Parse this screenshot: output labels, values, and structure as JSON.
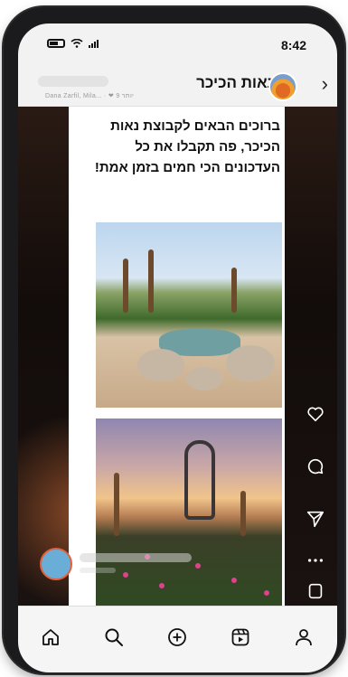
{
  "status_bar": {
    "time": "8:42"
  },
  "header": {
    "title": "נאות הכיכר",
    "subtitle": "Dana Zarfil,  Mila...  ·  ❤  9 יותר"
  },
  "post": {
    "text": "ברוכים הבאים לקבוצת נאות הכיכר, פה תקבלו את כל העדכונים הכי חמים בזמן אמת!",
    "images": [
      {
        "name": "oasis-palms-photo"
      },
      {
        "name": "sculpture-sunset-photo"
      }
    ]
  },
  "actions": [
    {
      "icon": "heart-icon"
    },
    {
      "icon": "comment-icon"
    },
    {
      "icon": "send-icon"
    },
    {
      "icon": "more-icon"
    },
    {
      "icon": "save-icon"
    }
  ],
  "nav": [
    {
      "icon": "home-icon"
    },
    {
      "icon": "search-icon"
    },
    {
      "icon": "create-icon"
    },
    {
      "icon": "reels-icon"
    },
    {
      "icon": "profile-icon"
    }
  ],
  "colors": {
    "accent_ring": "#e2603b",
    "avatar_fill": "#6aaed8",
    "heart_red": "#e0303b"
  }
}
